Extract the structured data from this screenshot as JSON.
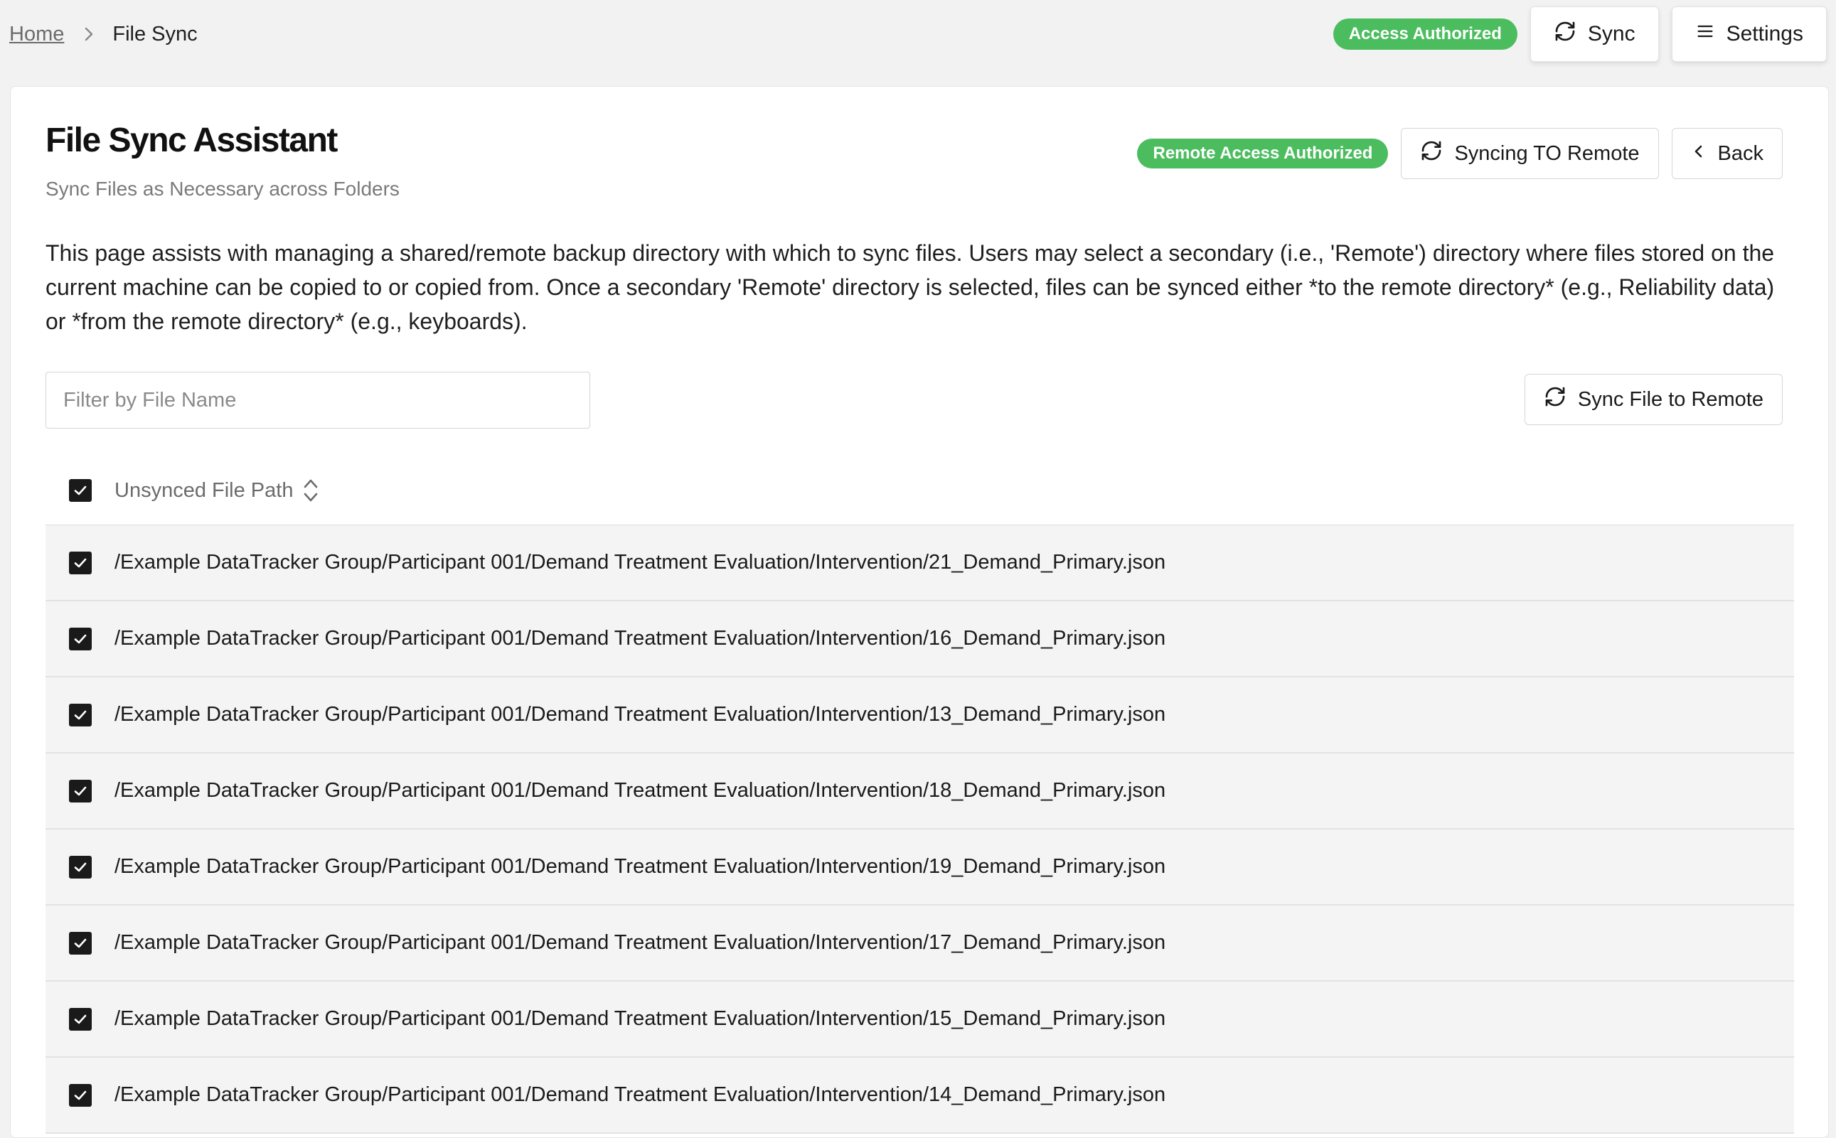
{
  "breadcrumb": {
    "home": "Home",
    "current": "File Sync"
  },
  "top_actions": {
    "access_badge": "Access Authorized",
    "sync_label": "Sync",
    "settings_label": "Settings"
  },
  "page": {
    "title": "File Sync Assistant",
    "subtitle": "Sync Files as Necessary across Folders",
    "remote_badge": "Remote Access Authorized",
    "direction_label": "Syncing TO Remote",
    "back_label": "Back",
    "description": "This page assists with managing a shared/remote backup directory with which to sync files. Users may select a secondary (i.e., 'Remote') directory where files stored on the current machine can be copied to or copied from. Once a secondary 'Remote' directory is selected, files can be synced either *to the remote directory* (e.g., Reliability data) or *from the remote directory* (e.g., keyboards)."
  },
  "filter": {
    "placeholder": "Filter by File Name",
    "value": ""
  },
  "sync_file_label": "Sync File to Remote",
  "table": {
    "header": "Unsynced File Path",
    "header_checked": true,
    "rows": [
      {
        "path": "/Example DataTracker Group/Participant 001/Demand Treatment Evaluation/Intervention/21_Demand_Primary.json",
        "checked": true
      },
      {
        "path": "/Example DataTracker Group/Participant 001/Demand Treatment Evaluation/Intervention/16_Demand_Primary.json",
        "checked": true
      },
      {
        "path": "/Example DataTracker Group/Participant 001/Demand Treatment Evaluation/Intervention/13_Demand_Primary.json",
        "checked": true
      },
      {
        "path": "/Example DataTracker Group/Participant 001/Demand Treatment Evaluation/Intervention/18_Demand_Primary.json",
        "checked": true
      },
      {
        "path": "/Example DataTracker Group/Participant 001/Demand Treatment Evaluation/Intervention/19_Demand_Primary.json",
        "checked": true
      },
      {
        "path": "/Example DataTracker Group/Participant 001/Demand Treatment Evaluation/Intervention/17_Demand_Primary.json",
        "checked": true
      },
      {
        "path": "/Example DataTracker Group/Participant 001/Demand Treatment Evaluation/Intervention/15_Demand_Primary.json",
        "checked": true
      },
      {
        "path": "/Example DataTracker Group/Participant 001/Demand Treatment Evaluation/Intervention/14_Demand_Primary.json",
        "checked": true
      }
    ]
  },
  "colors": {
    "accent_green": "#4cbd5f",
    "checkbox": "#1a1a1a",
    "row_bg": "#f4f4f4"
  },
  "icons": {
    "sync": "sync-icon",
    "settings": "menu-icon",
    "back": "chevron-left-icon",
    "sort": "sort-icon",
    "separator": "chevron-right-icon"
  }
}
